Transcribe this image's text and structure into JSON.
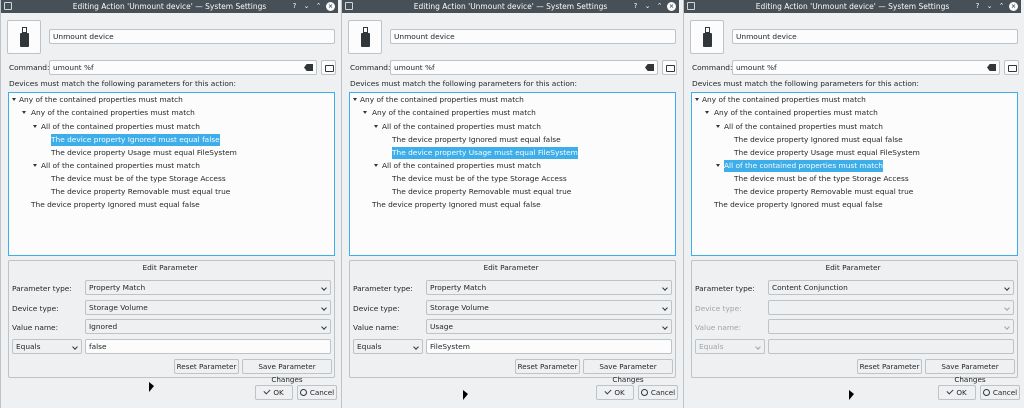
{
  "window_title": "Editing Action 'Unmount device' — System Settings",
  "title_buttons": [
    "?",
    "⌄",
    "⌃",
    "×"
  ],
  "action_name": "Unmount device",
  "command_label": "Command:",
  "command_value": "umount %f",
  "devices_label": "Devices must match the following parameters for this action:",
  "tree_items": [
    "Any of the contained properties must match",
    "Any of the contained properties must match",
    "All of the contained properties must match",
    "The device property Ignored must equal false",
    "The device property Usage must equal FileSystem",
    "All of the contained properties must match",
    "The device must be of the type Storage Access",
    "The device property Removable must equal true",
    "The device property Ignored must equal false"
  ],
  "edit_parameter_title": "Edit Parameter",
  "labels": {
    "parameter_type": "Parameter type:",
    "device_type": "Device type:",
    "value_name": "Value name:"
  },
  "buttons": {
    "reset": "Reset Parameter",
    "save": "Save Parameter Changes",
    "ok": "OK",
    "cancel": "Cancel"
  },
  "panels": [
    {
      "selected_item": 3,
      "parameter_type": "Property Match",
      "device_type": "Storage Volume",
      "value_name": "Ignored",
      "comparison": "Equals",
      "value": "false",
      "fields_enabled": true
    },
    {
      "selected_item": 4,
      "parameter_type": "Property Match",
      "device_type": "Storage Volume",
      "value_name": "Usage",
      "comparison": "Equals",
      "value": "FileSystem",
      "fields_enabled": true
    },
    {
      "selected_item": 5,
      "parameter_type": "Content Conjunction",
      "device_type": "",
      "value_name": "",
      "comparison": "Equals",
      "value": "",
      "fields_enabled": false
    }
  ],
  "colors": {
    "selection": "#3daee9",
    "titlebar": "#475057",
    "window_bg": "#eff0f1"
  }
}
